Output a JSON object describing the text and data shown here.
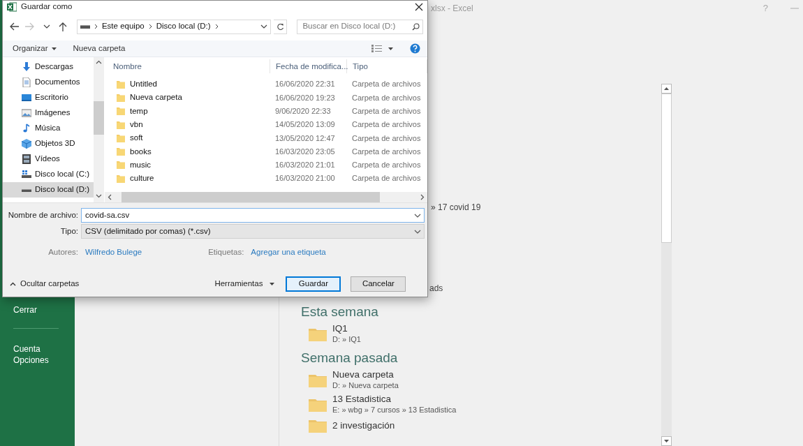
{
  "background_app": {
    "title": "xlsx - Excel",
    "help_glyph": "?",
    "sidebar": [
      {
        "label": "Cerrar",
        "divider_after": true
      },
      {
        "label": "Cuenta",
        "divider_after": false
      },
      {
        "label": "Opciones",
        "divider_after": false
      }
    ],
    "partial_texts": [
      "» 17 covid 19",
      "ads"
    ],
    "recent_groups": [
      {
        "heading": "Esta semana",
        "items": [
          {
            "name": "IQ1",
            "path": "D: » IQ1"
          }
        ]
      },
      {
        "heading": "Semana pasada",
        "items": [
          {
            "name": "Nueva carpeta",
            "path": "D: » Nueva carpeta"
          },
          {
            "name": "13 Estadistica",
            "path": "E: » wbg » 7 cursos » 13 Estadistica"
          },
          {
            "name": "2 investigación"
          }
        ]
      }
    ]
  },
  "dialog": {
    "title": "Guardar como",
    "nav_buttons": [
      {
        "kind": "back",
        "disabled": false
      },
      {
        "kind": "forward",
        "disabled": true
      },
      {
        "kind": "recent",
        "disabled": false
      },
      {
        "kind": "up",
        "disabled": false
      }
    ],
    "breadcrumb": [
      "Este equipo",
      "Disco local (D:)"
    ],
    "search": {
      "placeholder": "Buscar en Disco local (D:)"
    },
    "toolbar": {
      "organize": "Organizar",
      "new_folder": "Nueva carpeta"
    },
    "nav_pane": [
      {
        "label": "Descargas",
        "kind": "download",
        "selected": false
      },
      {
        "label": "Documentos",
        "kind": "documents",
        "selected": false
      },
      {
        "label": "Escritorio",
        "kind": "desktop",
        "selected": false
      },
      {
        "label": "Imágenes",
        "kind": "pictures",
        "selected": false
      },
      {
        "label": "Música",
        "kind": "music",
        "selected": false
      },
      {
        "label": "Objetos 3D",
        "kind": "objects3d",
        "selected": false
      },
      {
        "label": "Vídeos",
        "kind": "videos",
        "selected": false
      },
      {
        "label": "Disco local (C:)",
        "kind": "system_drive",
        "selected": false
      },
      {
        "label": "Disco local (D:)",
        "kind": "drive",
        "selected": true
      }
    ],
    "columns": [
      "Nombre",
      "Fecha de modifica...",
      "Tipo"
    ],
    "files": [
      {
        "name": "Untitled",
        "date": "16/06/2020 22:31",
        "type": "Carpeta de archivos"
      },
      {
        "name": "Nueva carpeta",
        "date": "16/06/2020 19:23",
        "type": "Carpeta de archivos"
      },
      {
        "name": "temp",
        "date": "9/06/2020 22:33",
        "type": "Carpeta de archivos"
      },
      {
        "name": "vbn",
        "date": "14/05/2020 13:09",
        "type": "Carpeta de archivos"
      },
      {
        "name": "soft",
        "date": "13/05/2020 12:47",
        "type": "Carpeta de archivos"
      },
      {
        "name": "books",
        "date": "16/03/2020 23:05",
        "type": "Carpeta de archivos"
      },
      {
        "name": "music",
        "date": "16/03/2020 21:01",
        "type": "Carpeta de archivos"
      },
      {
        "name": "culture",
        "date": "16/03/2020 21:00",
        "type": "Carpeta de archivos"
      }
    ],
    "filename": {
      "label": "Nombre de archivo:",
      "value": "covid-sa.csv"
    },
    "file_type": {
      "label": "Tipo:",
      "value": "CSV (delimitado por comas) (*.csv)"
    },
    "authors": {
      "label": "Autores:",
      "value": "Wilfredo Bulege"
    },
    "tags": {
      "label": "Etiquetas:",
      "value": "Agregar una etiqueta"
    },
    "hide_folders": "Ocultar carpetas",
    "tools": "Herramientas",
    "buttons": [
      {
        "label": "Guardar",
        "kind": "default"
      },
      {
        "label": "Cancelar",
        "kind": "normal"
      }
    ]
  }
}
